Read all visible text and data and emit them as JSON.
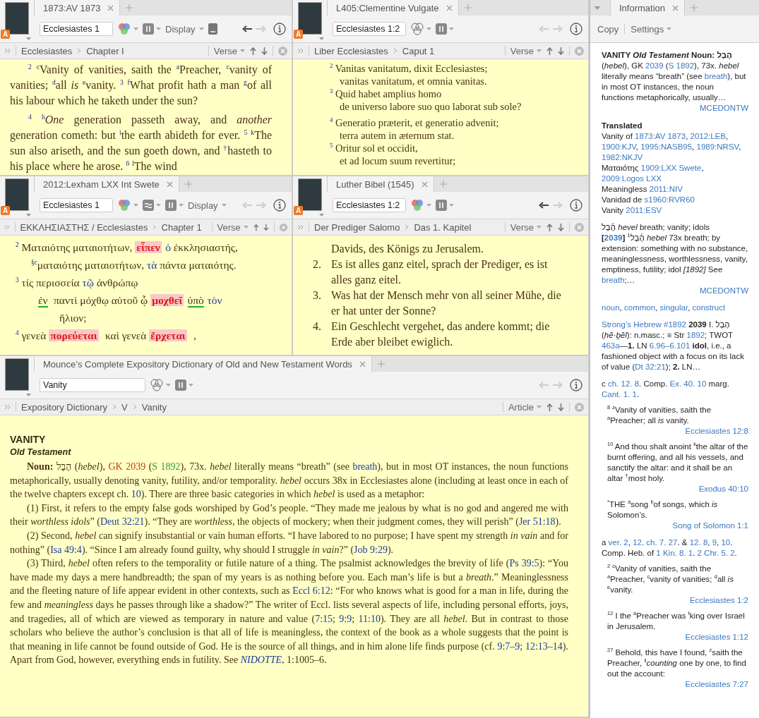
{
  "panels": [
    {
      "tab": {
        "title": "1873:AV 1873"
      },
      "badge": "A",
      "reference": "Ecclesiastes 1",
      "tools": [
        {
          "kind": "filter",
          "on": true
        },
        {
          "kind": "layout"
        },
        {
          "kind": "display",
          "label": "Display"
        },
        {
          "kind": "reader"
        }
      ],
      "nav": {
        "back_enabled": true,
        "forward_enabled": false
      },
      "breadcrumb": [
        "Ecclesiastes",
        "Chapter I"
      ],
      "unit": "Verse",
      "content": {
        "kind": "prose",
        "paragraphs": [
          "$^{2}$ $^{c}$Vanity of vanities, saith the $^{a}$Preacher, $^{c}$vanity of vanities; $^{d}$all *is* $^{e}$vanity. $^{3}$ $^{f}$What profit hath a man $^{g}$of all his labour which he taketh under the sun?",
          "$^{4}$ $^{h}$*One* generation passeth away, and *another* generation cometh: but $^{i}$the earth abideth for ever. $^{5}$ $^{k}$The sun also ariseth, and the sun goeth down, and $^{†}$hasteth to his place where he arose. $^{6}$ $^{l}$The wind"
        ]
      }
    },
    {
      "tab": {
        "title": "L405:Clementine Vulgate"
      },
      "badge": "A",
      "reference": "Ecclesiastes 1:2",
      "tools": [
        {
          "kind": "filter",
          "on": false
        },
        {
          "kind": "layout"
        }
      ],
      "nav": {
        "back_enabled": false,
        "forward_enabled": false
      },
      "breadcrumb": [
        "Liber Ecclesiastes",
        "Caput 1"
      ],
      "unit": "Verse",
      "content": {
        "kind": "stanzas",
        "stanzas": [
          [
            {
              "kind": "verse",
              "text": "$^{2}$ Vanitas vanitatum, dixit Ecclesiastes;"
            },
            {
              "kind": "cont",
              "text": "vanitas vanitatum, et omnia vanitas."
            },
            {
              "kind": "verse",
              "text": "$^{3}$ Quid habet amplius homo"
            },
            {
              "kind": "cont",
              "text": "de universo labore suo quo laborat sub sole?"
            }
          ],
          [
            {
              "kind": "verse",
              "text": "$^{4}$ Generatio præterit, et generatio advenit;"
            },
            {
              "kind": "cont",
              "text": "terra autem in æternum stat."
            },
            {
              "kind": "verse",
              "text": "$^{5}$ Oritur sol et occidit,"
            },
            {
              "kind": "cont",
              "text": "et ad locum suum revertitur;"
            }
          ]
        ]
      }
    },
    {
      "tab": {
        "title": "2012:Lexham LXX Int Swete"
      },
      "badge": "A",
      "reference": "Ecclesiastes 1",
      "tools": [
        {
          "kind": "filter",
          "on": true
        },
        {
          "kind": "interlinear"
        },
        {
          "kind": "layout"
        },
        {
          "kind": "display",
          "label": "Display"
        }
      ],
      "nav": {
        "back_enabled": false,
        "forward_enabled": false
      },
      "breadcrumb": [
        "ΕΚΚΛΗΣΙΑΣΤΗΣ / Ecclesiastes",
        "Chapter 1"
      ],
      "unit": "Verse",
      "content": {
        "kind": "interlinear",
        "lines": [
          {
            "kind": "verse",
            "segments": [
              "$^{2}$ Ματαιότης ματαιοτήτων, ",
              {
                "kind": "hl",
                "text": "εἶπεν"
              },
              {
                "kind": "link",
                "text": "ὁ"
              },
              " ἐκκλησιαστής,"
            ]
          },
          {
            "kind": "cont",
            "segments": [
              "$^{§c}$ματαιότης ματαιοτήτων, ",
              {
                "kind": "link",
                "text": "τὰ"
              },
              " πάντα ματαιότης."
            ]
          },
          {
            "kind": "verse",
            "segments": [
              "$^{3}$ τίς περισσεία ",
              {
                "kind": "link",
                "text": "τῷ"
              },
              " ἀνθρώπῳ"
            ]
          },
          {
            "kind": "cont2",
            "segments": [
              {
                "kind": "ul",
                "text": "ἐν"
              },
              " παντὶ μόχθῳ αὐτοῦ ᾧ ",
              {
                "kind": "hl",
                "text": "μοχθεῖ"
              },
              {
                "kind": "ul",
                "text": "ὑπὸ"
              },
              {
                "kind": "link",
                "text": "τὸν"
              }
            ]
          },
          {
            "kind": "cont3",
            "segments": [
              "ἥλιον;"
            ]
          },
          {
            "kind": "verse",
            "segments": [
              "$^{4}$ γενεὰ ",
              {
                "kind": "hl",
                "text": "πορεύεται"
              },
              " καὶ γενεὰ ",
              {
                "kind": "hl",
                "text": "ἔρχεται"
              },
              " ,"
            ]
          }
        ]
      }
    },
    {
      "tab": {
        "title": "Luther Bibel (1545)"
      },
      "badge": "A",
      "reference": "Ecclesiastes 1:2",
      "tools": [
        {
          "kind": "filter",
          "on": true
        },
        {
          "kind": "layout"
        }
      ],
      "nav": {
        "back_enabled": true,
        "forward_enabled": false
      },
      "breadcrumb": [
        "Der Prediger Salomo",
        "Das 1. Kapitel"
      ],
      "unit": "Verse",
      "content": {
        "kind": "numbered",
        "lead": "Davids, des Königs zu Jerusalem.",
        "items": [
          {
            "number": "2.",
            "text": "Es ist alles ganz eitel, sprach der Prediger, es ist alles ganz eitel."
          },
          {
            "number": "3.",
            "text": "Was hat der Mensch mehr von all seiner Mühe, die er hat unter der Sonne?"
          },
          {
            "number": "4.",
            "text": "Ein Geschlecht vergehet, das andere kommt; die Erde aber bleibet ewiglich."
          }
        ]
      }
    },
    {
      "tab": {
        "title": "Mounce’s Complete Expository Dictionary of Old and New Testament Words"
      },
      "reference": "Vanity",
      "tools": [
        {
          "kind": "filter",
          "on": false
        },
        {
          "kind": "layout"
        }
      ],
      "nav": {
        "back_enabled": false,
        "forward_enabled": false
      },
      "breadcrumb": [
        "Expository Dictionary",
        "V",
        "Vanity"
      ],
      "unit": "Article",
      "content": {
        "kind": "article",
        "title": "VANITY",
        "subtitle": "Old Testament",
        "paragraphs": [
          [
            "**Noun:** הֶבֶל (*hebel*), ",
            {
              "kind": "gk",
              "text": "GK 2039"
            },
            " (",
            {
              "kind": "strong",
              "text": "S 1892"
            },
            "), 73x. *hebel* literally means “breath” (see ",
            {
              "kind": "link",
              "text": "breath"
            },
            "), but in most OT instances, the noun functions metaphorically, usually denoting vanity, futility, and/or temporality. *hebel* occurs 38x in Ecclesiastes alone (including at least once in each of the twelve chapters except ch. ",
            {
              "kind": "link",
              "text": "10"
            },
            "). There are three basic categories in which *hebel* is used as a metaphor:"
          ],
          [
            "(1) First, it refers to the empty false gods worshiped by God’s people. “They made me jealous by what is no god and angered me with their *worthless idols*” (",
            {
              "kind": "link",
              "text": "Deut 32:21"
            },
            "). “They are *worthless*, the objects of mockery; when their judgment comes, they will perish” (",
            {
              "kind": "link",
              "text": "Jer 51:18"
            },
            ")."
          ],
          [
            "(2) Second, *hebel* can signify insubstantial or vain human efforts. “I have labored to no purpose; I have spent my strength *in vain* and for nothing” (",
            {
              "kind": "link",
              "text": "Isa 49:4"
            },
            "). “Since I am already found guilty, why should I struggle *in vain*?” (",
            {
              "kind": "link",
              "text": "Job 9:29"
            },
            ")."
          ],
          [
            "(3) Third, *hebel* often refers to the temporality or futile nature of a thing. The psalmist acknowledges the brevity of life (",
            {
              "kind": "link",
              "text": "Ps 39:5"
            },
            "): “You have made my days a mere handbreadth; the span of my years is as nothing before you. Each man’s life is but a *breath*.” Meaninglessness and the fleeting nature of life appear evident in other contexts, such as ",
            {
              "kind": "link",
              "text": "Eccl 6:12"
            },
            ": “For who knows what is good for a man in life, during the few and *meaningless* days he passes through like a shadow?” The writer of Eccl. lists several aspects of life, including personal efforts, joys, and tragedies, all of which are viewed as temporary in nature and value (",
            {
              "kind": "link",
              "text": "7:15"
            },
            "; ",
            {
              "kind": "link",
              "text": "9:9"
            },
            "; ",
            {
              "kind": "link",
              "text": "11:10"
            },
            "). They are all *hebel*. But in contrast to those scholars who believe the author’s conclusion is that all of life is meaningless, the context of the book as a whole suggests that the point is that meaning in life cannot be found outside of God. He is the source of all things, and in him alone life finds purpose (cf. ",
            {
              "kind": "link",
              "text": "9:7–9"
            },
            "; ",
            {
              "kind": "link",
              "text": "12:13–14"
            },
            "). Apart from God, however, everything ends in futility. See ",
            {
              "kind": "link",
              "text": "*NIDOTTE*"
            },
            ", 1:1005–6."
          ]
        ]
      }
    }
  ],
  "sidebar": {
    "tab": {
      "title": "Information"
    },
    "toolbar": [
      {
        "kind": "button",
        "label": "Copy"
      },
      {
        "kind": "menu",
        "label": "Settings"
      }
    ],
    "blocks": [
      {
        "kind": "para",
        "segments": [
          "**VANITY *Old Testament* Noun: הֶבֶל** (*hebel*), GK ",
          {
            "kind": "link",
            "text": "2039"
          },
          " (",
          {
            "kind": "link",
            "text": "S 1892"
          },
          "), 73x. *hebel* literally means “breath” (see ",
          {
            "kind": "link",
            "text": "breath"
          },
          "), but in most OT instances, the noun functions metaphorically, usually…"
        ],
        "source": "MCEDONTW"
      },
      {
        "kind": "heading",
        "text": "Translated"
      },
      {
        "kind": "line",
        "segments": [
          "Vanity of ",
          {
            "kind": "link",
            "text": "1873:AV 1873"
          },
          ", ",
          {
            "kind": "link",
            "text": "2012:LEB"
          },
          ", ",
          {
            "kind": "link",
            "text": "1900:KJV"
          },
          ", ",
          {
            "kind": "link",
            "text": "1995:NASB95"
          },
          ", ",
          {
            "kind": "link",
            "text": "1989:NRSV"
          },
          ", ",
          {
            "kind": "link",
            "text": "1982:NKJV"
          }
        ]
      },
      {
        "kind": "line",
        "segments": [
          "Ματαιότης ",
          {
            "kind": "link",
            "text": "1909:LXX Swete"
          },
          ", ",
          {
            "kind": "link",
            "text": "2009:Logos LXX"
          }
        ]
      },
      {
        "kind": "line",
        "segments": [
          "Meaningless ",
          {
            "kind": "link",
            "text": "2011:NIV"
          }
        ]
      },
      {
        "kind": "line",
        "segments": [
          "Vanidad de ",
          {
            "kind": "link",
            "text": "s1960:RVR60"
          }
        ]
      },
      {
        "kind": "line",
        "segments": [
          "Vanity ",
          {
            "kind": "link",
            "text": "2011:ESV"
          }
        ]
      },
      {
        "kind": "para",
        "segments": [
          "הֶ֫בֶל *hevel* breath; vanity; idols"
        ]
      },
      {
        "kind": "line",
        "segments": [
          "**[**",
          {
            "kind": "link",
            "text": "**2039**"
          },
          "**]** הֶ֫בֶל$^{1}$ *hebel* 73x breath; by extension: something with no substance, meaninglessness, worthlessness, vanity, emptiness, futility; idol *[1892]* See ",
          {
            "kind": "link",
            "text": "breath"
          },
          ";…"
        ],
        "source": "MCEDONTW"
      },
      {
        "kind": "para",
        "segments": [
          {
            "kind": "link",
            "text": "noun"
          },
          ", ",
          {
            "kind": "link",
            "text": "common"
          },
          ", ",
          {
            "kind": "link",
            "text": "singular"
          },
          ", ",
          {
            "kind": "link",
            "text": "construct"
          }
        ]
      },
      {
        "kind": "para",
        "segments": [
          {
            "kind": "link",
            "text": "Strong’s Hebrew #1892"
          },
          " **2039** I. הֶבֶל (*hĕ·ḇĕl*): n.masc.; ≡ Str ",
          {
            "kind": "link",
            "text": "1892"
          },
          "; TWOT ",
          {
            "kind": "link",
            "text": "463a"
          },
          "—**1.** LN ",
          {
            "kind": "link",
            "text": "6.96–6.101"
          },
          " **idol**, i.e., a fashioned object with a focus on its lack of value (",
          {
            "kind": "link",
            "text": "Dt 32:21"
          },
          "); **2.** LN…"
        ]
      },
      {
        "kind": "para",
        "segments": [
          "c ",
          {
            "kind": "link",
            "text": "ch. 12. 8"
          },
          ". Comp. ",
          {
            "kind": "link",
            "text": "Ex. 40. 10"
          },
          " marg. ",
          {
            "kind": "link",
            "text": "Cant. 1. 1"
          },
          "."
        ]
      },
      {
        "kind": "quote",
        "segments": [
          "$^{8}$ $^{z}$Vanity of vanities, saith the $^{a}$Preacher; all *is* vanity."
        ],
        "source": "Ecclesiastes 12:8"
      },
      {
        "kind": "quote",
        "segments": [
          "$^{10}$ And thou shalt anoint $^{k}$the altar of the burnt offering, and all his vessels, and sanctify the altar: and it shall be an altar $^{†}$most holy."
        ],
        "source": "Exodus 40:10"
      },
      {
        "kind": "quote",
        "segments": [
          "$^{*}$THE $^{a}$song $^{b}$of songs, which *is* Solomon’s."
        ],
        "source": "Song of Solomon 1:1"
      },
      {
        "kind": "para",
        "segments": [
          "a ",
          {
            "kind": "link",
            "text": "ver. 2"
          },
          ", ",
          {
            "kind": "link",
            "text": "12"
          },
          ". ",
          {
            "kind": "link",
            "text": "ch. 7. 27"
          },
          ". & ",
          {
            "kind": "link",
            "text": "12. 8"
          },
          ", ",
          {
            "kind": "link",
            "text": "9"
          },
          ", ",
          {
            "kind": "link",
            "text": "10"
          },
          ". Comp. Heb. of ",
          {
            "kind": "link",
            "text": "1 Kin. 8. 1"
          },
          ". ",
          {
            "kind": "link",
            "text": "2 Chr. 5. 2"
          },
          "."
        ]
      },
      {
        "kind": "quote",
        "segments": [
          "$^{2}$ $^{c}$Vanity of vanities, saith the $^{a}$Preacher, $^{c}$vanity of vanities; $^{d}$all *is* $^{e}$vanity."
        ],
        "source": "Ecclesiastes 1:2"
      },
      {
        "kind": "quote",
        "segments": [
          "$^{12}$ I the $^{a}$Preacher was $^{t}$king over Israel in Jerusalem."
        ],
        "source": "Ecclesiastes 1:12"
      },
      {
        "kind": "quote",
        "segments": [
          "$^{27}$ Behold, this have I found, $^{z}$saith the Preacher, $^{‖}$*counting* one by one, to find out the account:"
        ],
        "source": "Ecclesiastes 7:27"
      }
    ]
  }
}
